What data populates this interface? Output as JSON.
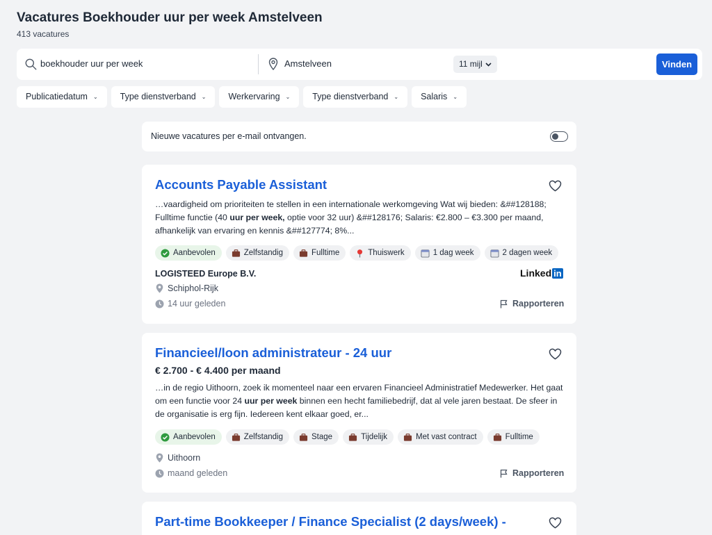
{
  "header": {
    "title": "Vacatures Boekhouder uur per week Amstelveen",
    "count": "413 vacatures"
  },
  "search": {
    "query": "boekhouder uur per week",
    "location": "Amstelveen",
    "radius": "11 mijl",
    "find_label": "Vinden"
  },
  "filters": [
    "Publicatiedatum",
    "Type dienstverband",
    "Werkervaring",
    "Type dienstverband",
    "Salaris"
  ],
  "alert": {
    "text": "Nieuwe vacatures per e-mail ontvangen.",
    "enabled": false
  },
  "jobs": [
    {
      "title": "Accounts Payable Assistant",
      "snippet_lines": [
        [
          "…vaardigheid om prioriteiten te stellen in een internationale werkomgeving Wat wij bieden: &##128188;"
        ],
        [
          "Fulltime functie (40 ",
          "uur per week,",
          " optie voor 32 uur) &##128176; Salaris: €2.800 – €3.300 per maand,"
        ],
        [
          "afhankelijk van ervaring en kennis &##127774; 8%..."
        ]
      ],
      "tags": [
        {
          "label": "Aanbevolen",
          "icon": "check-circle-icon"
        },
        {
          "label": "Zelfstandig",
          "icon": "briefcase-icon"
        },
        {
          "label": "Fulltime",
          "icon": "briefcase-icon"
        },
        {
          "label": "Thuiswerk",
          "icon": "pushpin-icon"
        },
        {
          "label": "1 dag week",
          "icon": "calendar-icon"
        },
        {
          "label": "2 dagen week",
          "icon": "calendar-icon"
        }
      ],
      "company": "LOGISTEED Europe B.V.",
      "source": {
        "text": "Linked",
        "badge": "in"
      },
      "location": "Schiphol-Rijk",
      "posted": "14 uur geleden",
      "report_label": "Rapporteren"
    },
    {
      "title": "Financieel/loon administrateur - 24 uur",
      "salary": "€ 2.700 - € 4.400 per maand",
      "snippet_lines": [
        [
          "…in de regio Uithoorn, zoek ik momenteel naar een ervaren Financieel Administratief Medewerker. Het gaat"
        ],
        [
          "om een functie voor 24 ",
          "uur per week",
          " binnen een hecht familiebedrijf, dat al vele jaren bestaat. De sfeer in"
        ],
        [
          "de organisatie is erg fijn. Iedereen kent elkaar goed, er..."
        ]
      ],
      "tags": [
        {
          "label": "Aanbevolen",
          "icon": "check-circle-icon"
        },
        {
          "label": "Zelfstandig",
          "icon": "briefcase-icon"
        },
        {
          "label": "Stage",
          "icon": "briefcase-icon"
        },
        {
          "label": "Tijdelijk",
          "icon": "briefcase-icon"
        },
        {
          "label": "Met vast contract",
          "icon": "briefcase-icon"
        },
        {
          "label": "Fulltime",
          "icon": "briefcase-icon"
        }
      ],
      "location": "Uithoorn",
      "posted": "maand geleden",
      "report_label": "Rapporteren"
    },
    {
      "title": "Part-time Bookkeeper / Finance Specialist (2 days/week) -"
    }
  ],
  "colors": {
    "accent": "#1a5fd8",
    "background": "#f2f3f5",
    "recommended": "#2e9a3e",
    "linkedin": "#0a66c2"
  }
}
